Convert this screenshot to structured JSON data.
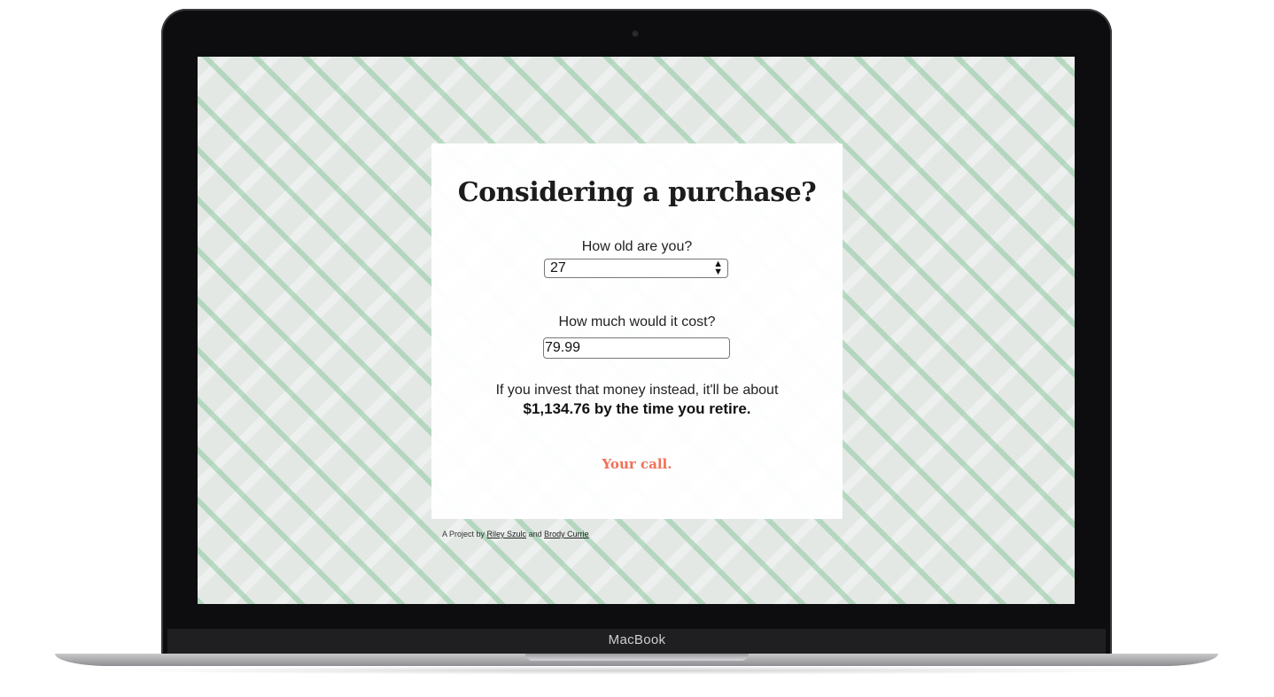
{
  "device": {
    "brand_label": "MacBook"
  },
  "page": {
    "title": "Considering a purchase?",
    "age": {
      "label": "How old are you?",
      "selected": "27"
    },
    "cost": {
      "label": "How much would it cost?",
      "value": "79.99"
    },
    "result": {
      "intro": "If you invest that money instead, it'll be about",
      "amount_line": "$1,134.76 by the time you retire."
    },
    "call_to_action": "Your call.",
    "credit": {
      "prefix": "A Project by",
      "author1": "Riley Szulc",
      "joiner": "and",
      "author2": "Brody Currie"
    }
  },
  "colors": {
    "accent": "#f07058",
    "pattern_green": "#8cc8a0",
    "screen_bg": "#e4e8e5"
  }
}
